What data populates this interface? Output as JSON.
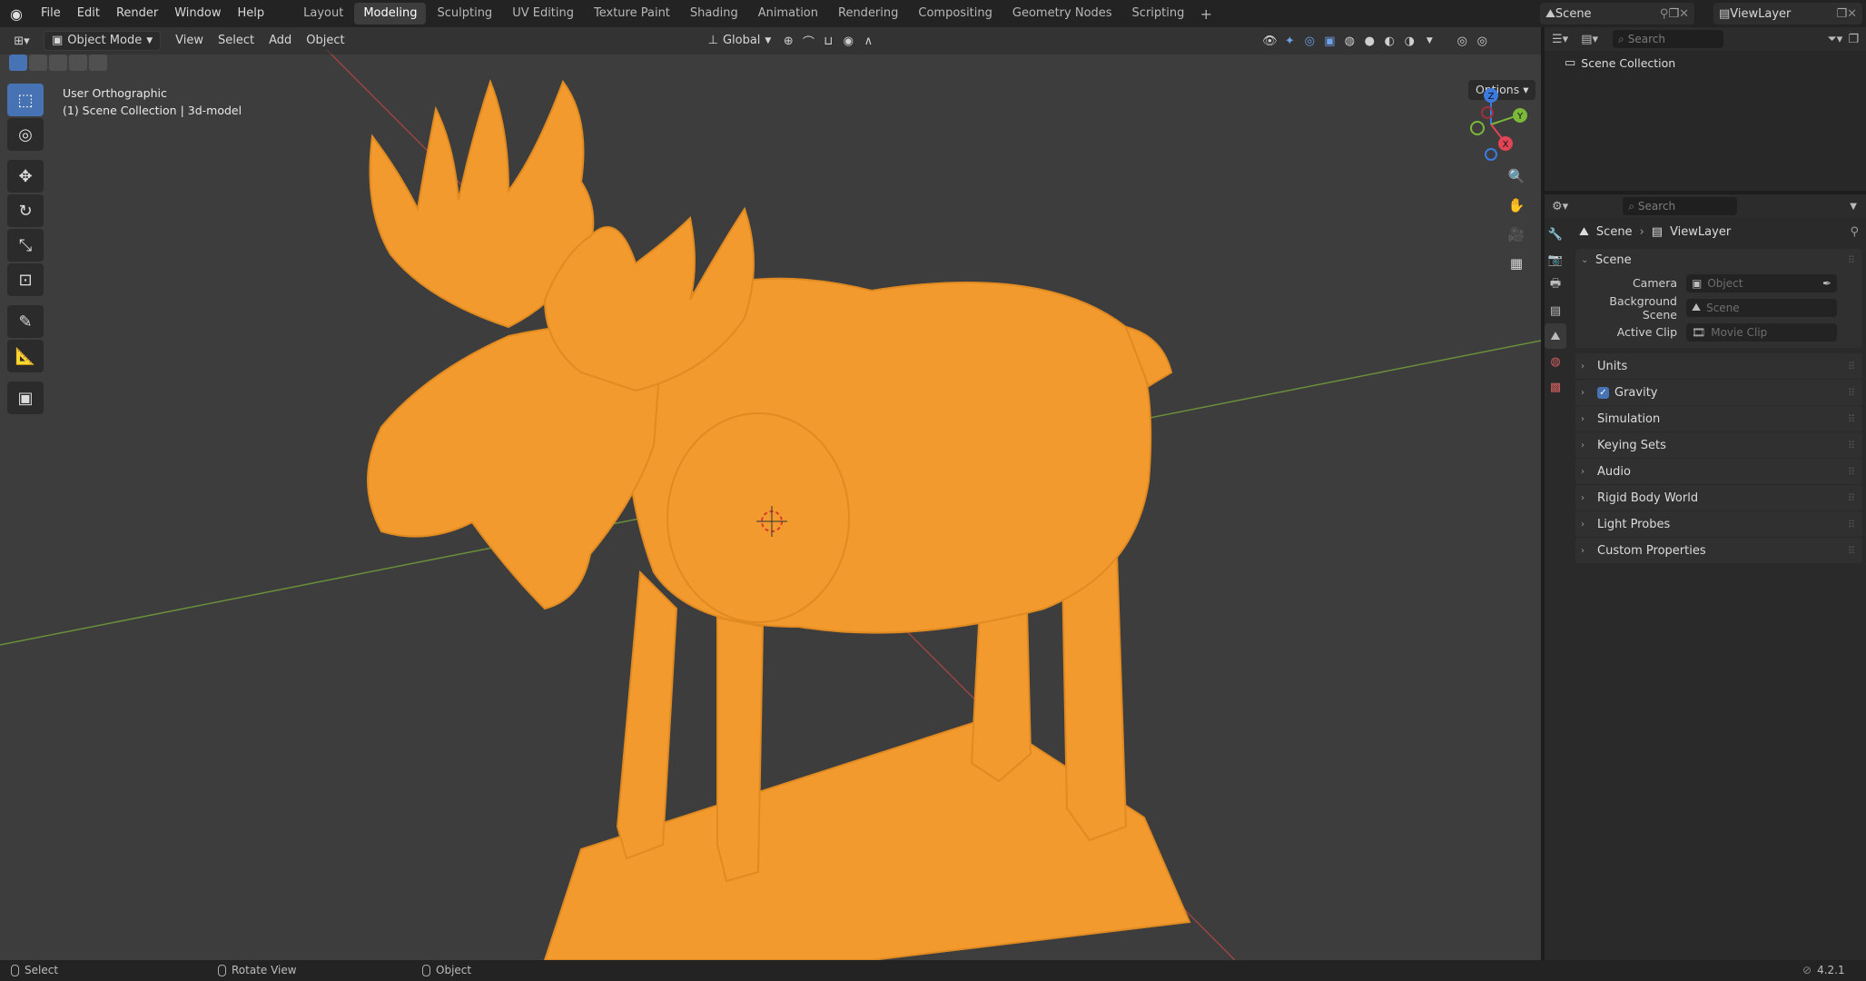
{
  "topbar": {
    "menu": [
      "File",
      "Edit",
      "Render",
      "Window",
      "Help"
    ],
    "workspaces": [
      "Layout",
      "Modeling",
      "Sculpting",
      "UV Editing",
      "Texture Paint",
      "Shading",
      "Animation",
      "Rendering",
      "Compositing",
      "Geometry Nodes",
      "Scripting"
    ],
    "active_workspace": "Modeling",
    "add_symbol": "+",
    "scene_name": "Scene",
    "view_layer_name": "ViewLayer"
  },
  "viewport": {
    "mode": "Object Mode",
    "menus": [
      "View",
      "Select",
      "Add",
      "Object"
    ],
    "transform_orientation": "Global",
    "options_label": "Options",
    "view_name": "User Orthographic",
    "collection_info": "(1) Scene Collection | 3d-model",
    "model_color": "#f29a2e",
    "gizmo": {
      "x": "X",
      "y": "Y",
      "z": "Z"
    }
  },
  "outliner": {
    "search_placeholder": "Search",
    "root": "Scene Collection"
  },
  "properties": {
    "search_placeholder": "Search",
    "breadcrumb": [
      "Scene",
      "ViewLayer"
    ],
    "scene_section": "Scene",
    "fields": [
      {
        "label": "Camera",
        "value": "Object"
      },
      {
        "label": "Background Scene",
        "value": "Scene"
      },
      {
        "label": "Active Clip",
        "value": "Movie Clip"
      }
    ],
    "panels": [
      "Units",
      "Gravity",
      "Simulation",
      "Keying Sets",
      "Audio",
      "Rigid Body World",
      "Light Probes",
      "Custom Properties"
    ]
  },
  "statusbar": {
    "select": "Select",
    "rotate": "Rotate View",
    "object": "Object",
    "version": "4.2.1"
  }
}
